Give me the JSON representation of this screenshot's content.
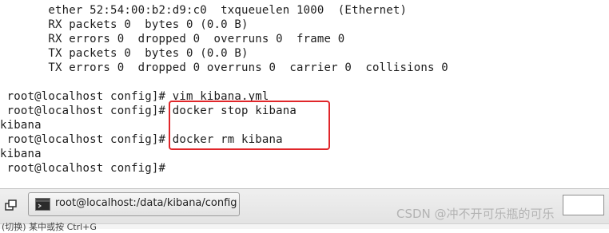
{
  "terminal": {
    "lines": [
      "       ether 52:54:00:b2:d9:c0  txqueuelen 1000  (Ethernet)",
      "       RX packets 0  bytes 0 (0.0 B)",
      "       RX errors 0  dropped 0  overruns 0  frame 0",
      "       TX packets 0  bytes 0 (0.0 B)",
      "       TX errors 0  dropped 0 overruns 0  carrier 0  collisions 0",
      "",
      " root@localhost config]# vim kibana.yml",
      " root@localhost config]# docker stop kibana",
      "kibana",
      " root@localhost config]# docker rm kibana",
      "kibana",
      " root@localhost config]# "
    ]
  },
  "taskbar": {
    "window_title": "root@localhost:/data/kibana/config",
    "show_desktop_icon": "show-desktop-icon",
    "terminal_icon": "terminal-icon"
  },
  "watermark": "CSDN @冲不开可乐瓶的可乐",
  "bottom_hint": "(切换) 某中或按 Ctrl+G"
}
